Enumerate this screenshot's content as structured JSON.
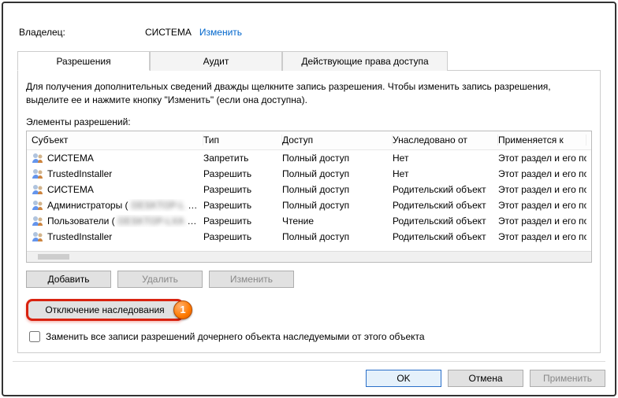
{
  "owner": {
    "label": "Владелец:",
    "value": "СИСТЕМА",
    "change_link": "Изменить"
  },
  "tabs": {
    "permissions": "Разрешения",
    "audit": "Аудит",
    "effective": "Действующие права доступа"
  },
  "help_text": "Для получения дополнительных сведений дважды щелкните запись разрешения. Чтобы изменить запись разрешения, выделите ее и нажмите кнопку \"Изменить\" (если она доступна).",
  "list_label": "Элементы разрешений:",
  "columns": {
    "subject": "Субъект",
    "type": "Тип",
    "access": "Доступ",
    "inherited": "Унаследовано от",
    "applies": "Применяется к"
  },
  "rows": [
    {
      "subject": "СИСТЕМА",
      "type": "Запретить",
      "access": "Полный доступ",
      "inherited": "Нет",
      "applies": "Этот раздел и его подр"
    },
    {
      "subject": "TrustedInstaller",
      "type": "Разрешить",
      "access": "Полный доступ",
      "inherited": "Нет",
      "applies": "Этот раздел и его подр"
    },
    {
      "subject": "СИСТЕМА",
      "type": "Разрешить",
      "access": "Полный доступ",
      "inherited": "Родительский объект",
      "applies": "Этот раздел и его подр"
    },
    {
      "subject": "Администраторы (",
      "subject_blur": "DESKTOP-L",
      "subject_tail": "…",
      "type": "Разрешить",
      "access": "Полный доступ",
      "inherited": "Родительский объект",
      "applies": "Этот раздел и его подр"
    },
    {
      "subject": "Пользователи (",
      "subject_blur": "DESKTOP-LXA",
      "subject_tail": "…",
      "type": "Разрешить",
      "access": "Чтение",
      "inherited": "Родительский объект",
      "applies": "Этот раздел и его подр"
    },
    {
      "subject": "TrustedInstaller",
      "type": "Разрешить",
      "access": "Полный доступ",
      "inherited": "Родительский объект",
      "applies": "Этот раздел и его подр"
    }
  ],
  "buttons": {
    "add": "Добавить",
    "remove": "Удалить",
    "edit": "Изменить",
    "disable_inherit": "Отключение наследования",
    "ok": "OK",
    "cancel": "Отмена",
    "apply": "Применить"
  },
  "checkbox_label": "Заменить все записи разрешений дочернего объекта наследуемыми от этого объекта",
  "marker": "1"
}
